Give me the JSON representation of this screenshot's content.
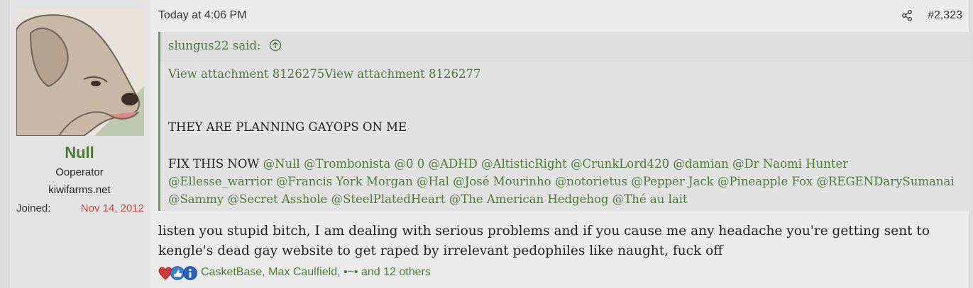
{
  "user": {
    "name": "Null",
    "title": "Ooperator",
    "banner": "kiwifarms.net",
    "joined_label": "Joined:",
    "joined_date": "Nov 14, 2012"
  },
  "post": {
    "timestamp": "Today at 4:06 PM",
    "number": "#2,323",
    "icons": {
      "share": "share-icon",
      "quote_arrow": "arrow-up-circle-icon"
    }
  },
  "quote": {
    "author": "slungus22 said:",
    "attachments": "View attachment 8126275View attachment 8126277",
    "line1": "THEY ARE PLANNING GAYOPS ON ME",
    "fix_prefix": "FIX THIS NOW",
    "mentions": [
      "@Null",
      "@Trombonista",
      "@0 0",
      "@ADHD",
      "@AltisticRight",
      "@CrunkLord420",
      "@damian",
      "@Dr Naomi Hunter",
      "@Ellesse_warrior",
      "@Francis York Morgan",
      "@Hal",
      "@José Mourinho",
      "@notorietus",
      "@Pepper Jack",
      "@Pineapple Fox",
      "@REGENDarySumanai",
      "@Sammy",
      "@Secret Asshole",
      "@SteelPlatedHeart",
      "@The American Hedgehog",
      "@Thé au lait"
    ]
  },
  "message": "listen you stupid bitch, I am dealing with serious problems and if you cause me any headache you're getting sent to kengle's dead gay website to get raped by irrelevant pedophiles like naught, fuck off",
  "reactions": {
    "icons": [
      "heart-icon",
      "thumbs-up-icon",
      "info-icon"
    ],
    "colors": {
      "heart": "#d23b3b",
      "like": "#3b7fd8",
      "info": "#2a62c4"
    },
    "text": "CasketBase, Max Caulfield, •~• and 12 others"
  }
}
